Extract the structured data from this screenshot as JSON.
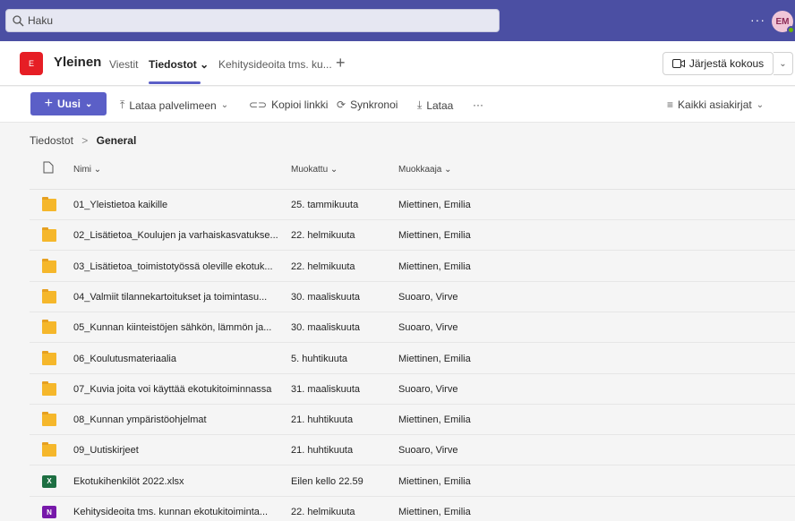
{
  "search": {
    "placeholder": "Haku"
  },
  "topbar": {
    "more": "···",
    "avatar_initials": "EM"
  },
  "channel": {
    "icon_letter": "E",
    "title": "Yleinen",
    "tabs": [
      {
        "label": "Viestit"
      },
      {
        "label": "Tiedostot ⌄"
      },
      {
        "label": "Kehitysideoita tms. ku..."
      }
    ],
    "add_tab": "+",
    "meet_label": "Järjestä kokous",
    "meet_chevron": "⌄"
  },
  "commands": {
    "new_label": "Uusi",
    "upload": "Lataa palvelimeen",
    "copy_link": "Kopioi linkki",
    "sync": "Synkronoi",
    "download": "Lataa",
    "more": "···",
    "view": "Kaikki asiakirjat"
  },
  "breadcrumb": {
    "root": "Tiedostot",
    "current": "General"
  },
  "columns": {
    "name": "Nimi ⌄",
    "modified": "Muokattu ⌄",
    "modified_by": "Muokkaaja ⌄"
  },
  "files": [
    {
      "type": "folder",
      "name": "01_Yleistietoa kaikille",
      "modified": "25. tammikuuta",
      "by": "Miettinen, Emilia"
    },
    {
      "type": "folder",
      "name": "02_Lisätietoa_Koulujen ja varhaiskasvatukse...",
      "modified": "22. helmikuuta",
      "by": "Miettinen, Emilia"
    },
    {
      "type": "folder",
      "name": "03_Lisätietoa_toimistotyössä oleville ekotuk...",
      "modified": "22. helmikuuta",
      "by": "Miettinen, Emilia"
    },
    {
      "type": "folder",
      "name": "04_Valmiit tilannekartoitukset ja toimintasu...",
      "modified": "30. maaliskuuta",
      "by": "Suoaro, Virve"
    },
    {
      "type": "folder",
      "name": "05_Kunnan kiinteistöjen sähkön, lämmön ja...",
      "modified": "30. maaliskuuta",
      "by": "Suoaro, Virve"
    },
    {
      "type": "folder",
      "name": "06_Koulutusmateriaalia",
      "modified": "5. huhtikuuta",
      "by": "Miettinen, Emilia"
    },
    {
      "type": "folder",
      "name": "07_Kuvia joita voi käyttää ekotukitoiminnassa",
      "modified": "31. maaliskuuta",
      "by": "Suoaro, Virve"
    },
    {
      "type": "folder",
      "name": "08_Kunnan ympäristöohjelmat",
      "modified": "21. huhtikuuta",
      "by": "Miettinen, Emilia"
    },
    {
      "type": "folder",
      "name": "09_Uutiskirjeet",
      "modified": "21. huhtikuuta",
      "by": "Suoaro, Virve"
    },
    {
      "type": "xlsx",
      "name": "Ekotukihenkilöt 2022.xlsx",
      "modified": "Eilen kello 22.59",
      "by": "Miettinen, Emilia"
    },
    {
      "type": "onenote",
      "name": "Kehitysideoita tms. kunnan ekotukitoiminta...",
      "modified": "22. helmikuuta",
      "by": "Miettinen, Emilia"
    }
  ],
  "colors": {
    "topbar": "#4b4fa3",
    "accent": "#5b5fc7",
    "folder": "#f5b72b",
    "channel_icon": "#e61e25"
  }
}
